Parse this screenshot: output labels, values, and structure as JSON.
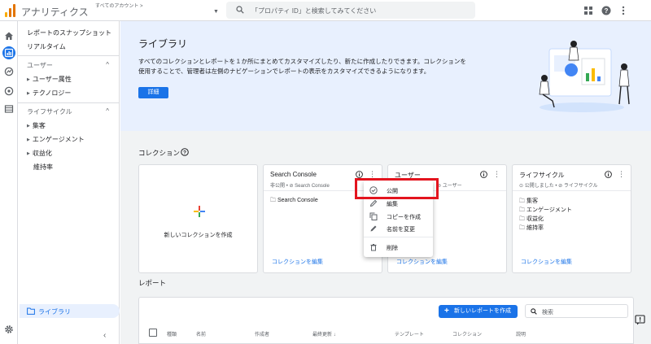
{
  "header": {
    "app_title": "アナリティクス",
    "account_label": "すべてのアカウント >",
    "search_placeholder": "「プロパティ ID」と検索してみてください",
    "icons": [
      "apps-icon",
      "help-icon",
      "more-vert-icon"
    ]
  },
  "rail": {
    "icons": [
      "home-icon",
      "reports-icon",
      "explore-icon",
      "advertising-icon",
      "configure-icon",
      "settings-icon"
    ]
  },
  "nav": {
    "items_top": [
      "レポートのスナップショット",
      "リアルタイム"
    ],
    "sections": [
      {
        "label": "ユーザー",
        "items": [
          "ユーザー属性",
          "テクノロジー"
        ]
      },
      {
        "label": "ライフサイクル",
        "items": [
          "集客",
          "エンゲージメント",
          "収益化"
        ],
        "extra": "維持率"
      }
    ],
    "library": "ライブラリ",
    "collapse": "‹"
  },
  "banner": {
    "title": "ライブラリ",
    "description_line1": "すべてのコレクションとレポートを１か所にまとめてカスタマイズしたり、新たに作成したりできます。コレクションを",
    "description_line2": "使用することで、管理者は左側のナビゲーションでレポートの表示をカスタマイズできるようになります。",
    "edit_button": "詳細"
  },
  "collections": {
    "title": "コレクション",
    "new_card_label": "新しいコレクションを作成",
    "cards": [
      {
        "title": "Search Console",
        "status": "非公開",
        "meta": "Search Console",
        "folders": [
          "Search Console"
        ],
        "link": "コレクションを編集"
      },
      {
        "title": "ユーザー",
        "status": "",
        "meta": "ユーザー",
        "folders": [],
        "link": "コレクションを編集"
      },
      {
        "title": "ライフサイクル",
        "status": "公開しました",
        "meta": "ライフサイクル",
        "folders": [
          "集客",
          "エンゲージメント",
          "収益化",
          "維持率"
        ],
        "link": "コレクションを編集"
      }
    ]
  },
  "context_menu": {
    "items": [
      {
        "label": "公開",
        "icon": "check-circle-icon"
      },
      {
        "label": "編集",
        "icon": "edit-icon"
      },
      {
        "label": "コピーを作成",
        "icon": "copy-icon"
      },
      {
        "label": "名前を変更",
        "icon": "rename-icon"
      },
      {
        "label": "削除",
        "icon": "delete-icon"
      }
    ],
    "highlight_color": "#e3141e"
  },
  "reports": {
    "title": "レポート",
    "new_button": "新しいレポートを作成",
    "search_placeholder": "検索",
    "columns": [
      "種類",
      "名前",
      "作成者",
      "最終更新",
      "テンプレート",
      "コレクション",
      "説明"
    ]
  },
  "colors": {
    "accent": "#1a73e8",
    "banner_bg": "#e8f0fe",
    "main_bg": "#f1f3f4"
  }
}
